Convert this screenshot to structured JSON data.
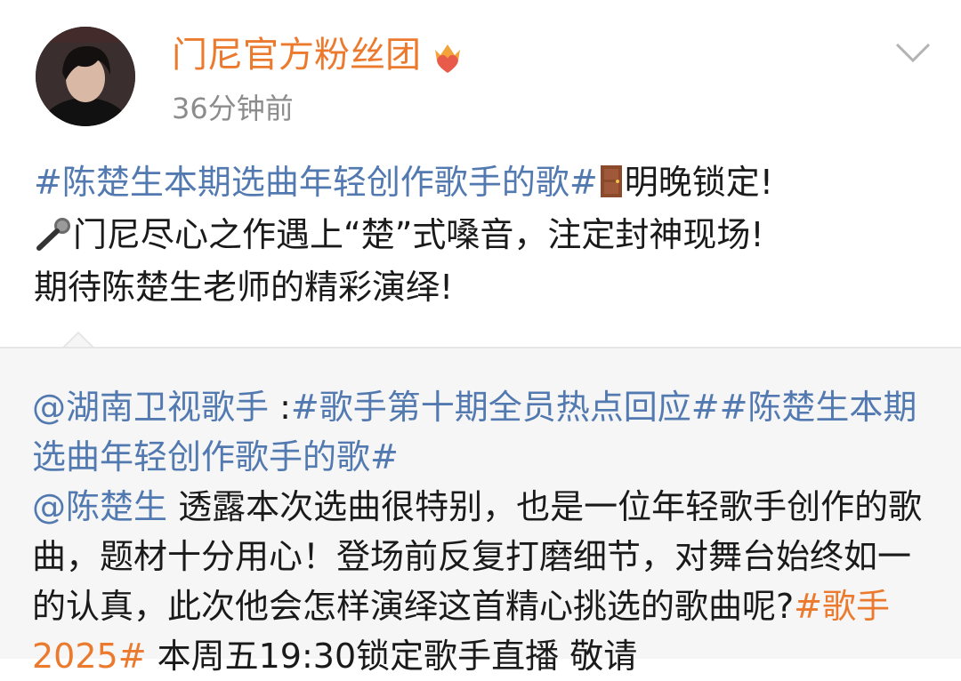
{
  "header": {
    "name": "门尼官方粉丝团",
    "time": "36分钟前"
  },
  "post": {
    "hashtag": "#陈楚生本期选曲年轻创作歌手的歌#",
    "line1_text": "明晚锁定!",
    "line2_text": "门尼尽心之作遇上“楚”式嗓音，注定封神现场!",
    "line3_text": "期待陈楚生老师的精彩演绎!"
  },
  "repost": {
    "mention_channel": "@湖南卫视歌手",
    "colon": " :",
    "hashtag1": "#歌手第十期全员热点回应#",
    "hashtag2": "#陈楚生本期选曲年轻创作歌手的歌#",
    "mention_singer": "@陈楚生",
    "body_text": " 透露本次选曲很特别，也是一位年轻歌手创作的歌曲，题材十分用心！登场前反复打磨细节，对舞台始终如一的认真，此次他会怎样演绎这首精心挑选的歌曲呢?",
    "hashtag3": "#歌手2025#",
    "tail_text": " 本周五19:30锁定歌手直播 敬请"
  },
  "icons": {
    "badge": "crown-heart-badge-icon",
    "chevron": "chevron-down-icon",
    "door": "door-icon",
    "mic": "microphone-icon"
  },
  "colors": {
    "name": "#eb7a2e",
    "link": "#5279b0",
    "time": "#8c8c8c",
    "repost_bg": "#f6f6f6"
  }
}
